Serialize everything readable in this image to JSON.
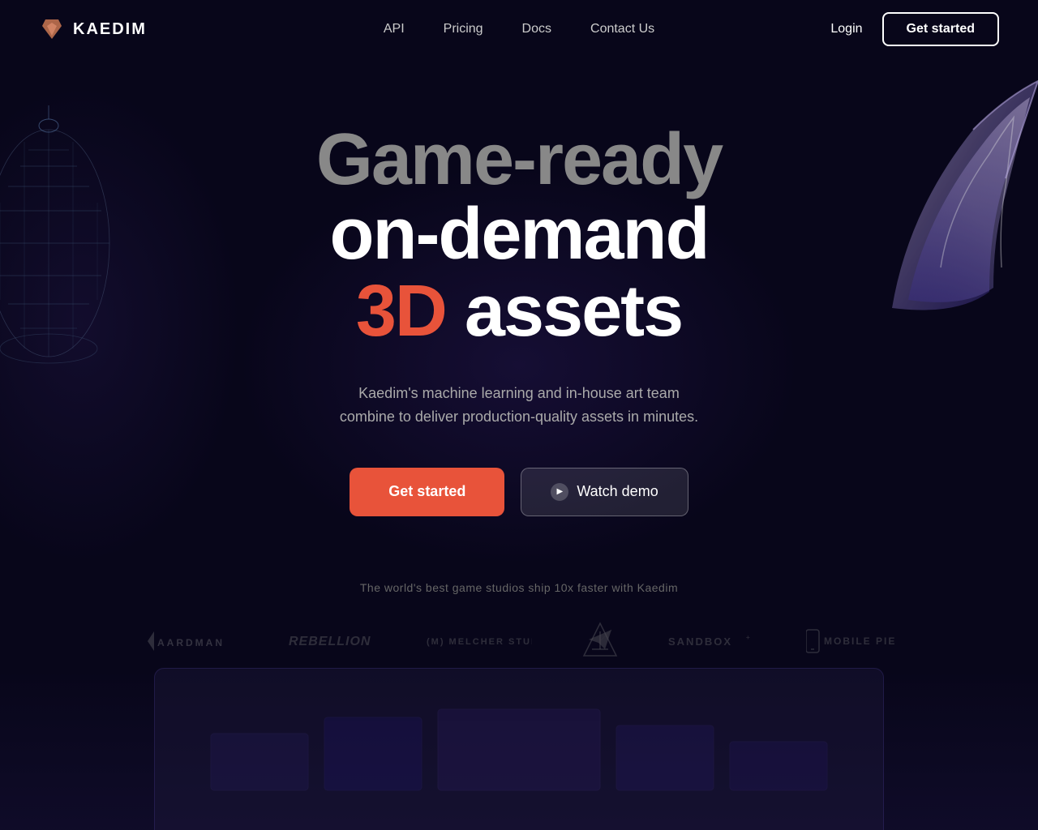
{
  "brand": {
    "name": "KAEDIM",
    "logo_color": "#c0714f"
  },
  "nav": {
    "links": [
      {
        "label": "API",
        "id": "api"
      },
      {
        "label": "Pricing",
        "id": "pricing"
      },
      {
        "label": "Docs",
        "id": "docs"
      },
      {
        "label": "Contact Us",
        "id": "contact"
      }
    ],
    "login_label": "Login",
    "get_started_label": "Get started"
  },
  "hero": {
    "line1": "Game-ready",
    "line2": "on-demand",
    "line3_prefix": "3D",
    "line3_suffix": " assets",
    "subtitle_line1": "Kaedim's machine learning and in-house art team",
    "subtitle_line2": "combine to deliver production-quality assets in minutes.",
    "btn_get_started": "Get started",
    "btn_watch_demo": "Watch demo"
  },
  "logos": {
    "tagline": "The world's best game studios ship 10x faster with Kaedim",
    "items": [
      {
        "label": "◂ AARDMAN",
        "id": "aardman"
      },
      {
        "label": "REBELLION",
        "id": "rebellion"
      },
      {
        "label": "(m) melcher studios",
        "id": "melcher"
      },
      {
        "label": "➤",
        "id": "arrow"
      },
      {
        "label": "SANDBOX",
        "id": "sandbox"
      },
      {
        "label": "mobile pie",
        "id": "mobilepie"
      }
    ]
  }
}
